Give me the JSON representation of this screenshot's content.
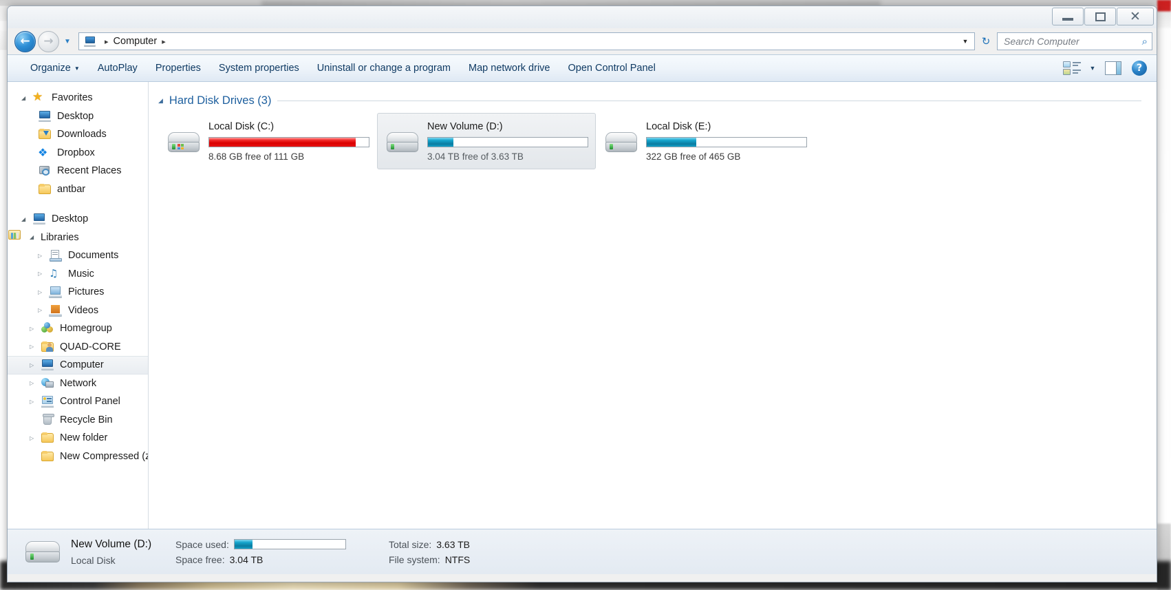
{
  "window": {
    "titlebar": {
      "minimize_label": "–",
      "maximize_label": "",
      "close_label": "✕"
    }
  },
  "address": {
    "back_label": "←",
    "forward_label": "→",
    "history_caret": "▼",
    "crumb_root": "Computer",
    "separator": "▸",
    "dropdown_caret": "▼",
    "refresh_label": "↻"
  },
  "search": {
    "placeholder": "Search Computer",
    "icon": "⌕"
  },
  "toolbar": {
    "items": [
      {
        "label": "Organize",
        "has_caret": true
      },
      {
        "label": "AutoPlay",
        "has_caret": false
      },
      {
        "label": "Properties",
        "has_caret": false
      },
      {
        "label": "System properties",
        "has_caret": false
      },
      {
        "label": "Uninstall or change a program",
        "has_caret": false
      },
      {
        "label": "Map network drive",
        "has_caret": false
      },
      {
        "label": "Open Control Panel",
        "has_caret": false
      }
    ],
    "caret": "▼",
    "view_caret": "▼",
    "help_label": "?"
  },
  "sidebar": {
    "items": [
      {
        "label": "Favorites",
        "icon": "star-icon",
        "indent": 0,
        "twisty": "open",
        "selected": false
      },
      {
        "label": "Desktop",
        "icon": "monitor-icon",
        "indent": 1,
        "twisty": "none",
        "selected": false
      },
      {
        "label": "Downloads",
        "icon": "downloads-icon",
        "indent": 1,
        "twisty": "none",
        "selected": false
      },
      {
        "label": "Dropbox",
        "icon": "dropbox-icon",
        "indent": 1,
        "twisty": "none",
        "selected": false
      },
      {
        "label": "Recent Places",
        "icon": "recent-places-icon",
        "indent": 1,
        "twisty": "none",
        "selected": false
      },
      {
        "label": "antbar",
        "icon": "folder-icon",
        "indent": 1,
        "twisty": "none",
        "selected": false
      },
      {
        "label": "__GAP__",
        "icon": "",
        "indent": 0,
        "twisty": "none",
        "selected": false
      },
      {
        "label": "Desktop",
        "icon": "monitor-icon",
        "indent": 0,
        "twisty": "open",
        "selected": false
      },
      {
        "label": "Libraries",
        "icon": "library-icon",
        "indent": 1,
        "twisty": "open",
        "selected": false
      },
      {
        "label": "Documents",
        "icon": "documents-icon",
        "indent": 2,
        "twisty": "closed",
        "selected": false
      },
      {
        "label": "Music",
        "icon": "music-icon",
        "indent": 2,
        "twisty": "closed",
        "selected": false
      },
      {
        "label": "Pictures",
        "icon": "pictures-icon",
        "indent": 2,
        "twisty": "closed",
        "selected": false
      },
      {
        "label": "Videos",
        "icon": "videos-icon",
        "indent": 2,
        "twisty": "closed",
        "selected": false
      },
      {
        "label": "Homegroup",
        "icon": "homegroup-icon",
        "indent": 1,
        "twisty": "closed",
        "selected": false
      },
      {
        "label": "QUAD-CORE",
        "icon": "user-folder-icon",
        "indent": 1,
        "twisty": "closed",
        "selected": false
      },
      {
        "label": "Computer",
        "icon": "computer-icon",
        "indent": 1,
        "twisty": "closed",
        "selected": true
      },
      {
        "label": "Network",
        "icon": "network-icon",
        "indent": 1,
        "twisty": "closed",
        "selected": false
      },
      {
        "label": "Control Panel",
        "icon": "control-panel-icon",
        "indent": 1,
        "twisty": "closed",
        "selected": false
      },
      {
        "label": "Recycle Bin",
        "icon": "recycle-bin-icon",
        "indent": 1,
        "twisty": "none",
        "selected": false
      },
      {
        "label": "New folder",
        "icon": "folder-icon",
        "indent": 1,
        "twisty": "closed",
        "selected": false
      },
      {
        "label": "New Compressed (zi",
        "icon": "folder-icon",
        "indent": 1,
        "twisty": "none",
        "selected": false
      }
    ],
    "twisty_open": "◢",
    "twisty_closed": "▷"
  },
  "content": {
    "group": {
      "title": "Hard Disk Drives (3)",
      "twisty": "◢"
    },
    "drives": [
      {
        "name": "Local Disk (C:)",
        "capacity_text": "8.68 GB free of 111 GB",
        "used_percent": 92,
        "bar_color": "red",
        "selected": false
      },
      {
        "name": "New Volume (D:)",
        "capacity_text": "3.04 TB free of 3.63 TB",
        "used_percent": 16,
        "bar_color": "blue",
        "selected": true
      },
      {
        "name": "Local Disk (E:)",
        "capacity_text": "322 GB free of 465 GB",
        "used_percent": 31,
        "bar_color": "blue",
        "selected": false
      }
    ]
  },
  "statusbar": {
    "title": "New Volume (D:)",
    "type": "Local Disk",
    "space_used_label": "Space used:",
    "space_used_percent": 16,
    "space_free_label": "Space free:",
    "space_free_value": "3.04 TB",
    "total_size_label": "Total size:",
    "total_size_value": "3.63 TB",
    "file_system_label": "File system:",
    "file_system_value": "NTFS"
  },
  "colors": {
    "accent_blue": "#1d5f9e",
    "bar_red": "#d90000",
    "bar_blue": "#0b7ba0"
  }
}
